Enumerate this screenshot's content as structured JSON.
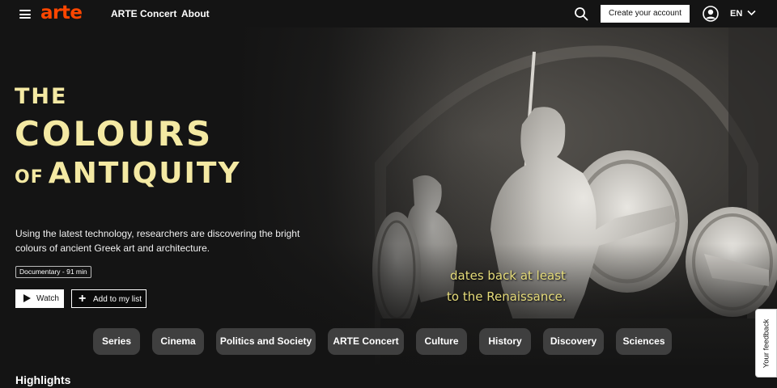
{
  "header": {
    "menu_icon": "hamburger-menu-icon",
    "logo": "arte",
    "nav": [
      "ARTE Concert",
      "About"
    ],
    "search_icon": "search-icon",
    "create_account": "Create your account",
    "user_icon": "user-circle-icon",
    "language": "EN",
    "language_icon": "chevron-down-icon"
  },
  "hero": {
    "title_line1": "THE",
    "title_line2": "COLOURS",
    "title_line3_small": "OF",
    "title_line3": "ANTIQUITY",
    "description": "Using the latest technology, researchers are discovering the bright colours of ancient Greek art and architecture.",
    "meta": "Documentary - 91 min",
    "watch_label": "Watch",
    "watch_icon": "play-icon",
    "add_list_label": "Add to my list",
    "add_list_icon": "plus-icon",
    "video_subtitle_line1": "dates back at least",
    "video_subtitle_line2": "to the Renaissance."
  },
  "categories": [
    "Series",
    "Cinema",
    "Politics and Society",
    "ARTE Concert",
    "Culture",
    "History",
    "Discovery",
    "Sciences"
  ],
  "highlights_title": "Highlights",
  "feedback_label": "Your feedback",
  "colors": {
    "brand": "#fd4600",
    "title_accent": "#f4e9a3",
    "subtitle_text": "#e6dc7a",
    "chip_bg": "#3f3f3f",
    "background": "#141414"
  }
}
